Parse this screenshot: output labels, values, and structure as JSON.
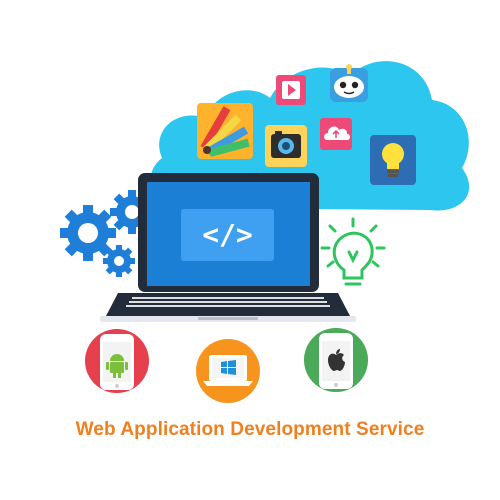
{
  "caption": "Web Application Development Service",
  "screen": {
    "code_symbol": "</>"
  },
  "colors": {
    "cloud": "#2dc6ee",
    "gear": "#1f7fd8",
    "laptop_body": "#232c3a",
    "laptop_screen": "#1b7fd6",
    "caption": "#f07f1e",
    "bulb_green": "#2ec55f",
    "android_circle": "#e6404f",
    "windows_circle": "#f7941d",
    "apple_circle": "#4aaa5a"
  },
  "icons": {
    "cloud_apps": [
      "palette-icon",
      "play-icon",
      "robot-icon",
      "camera-icon",
      "upload-cloud-icon",
      "lightbulb-icon"
    ],
    "platforms": [
      "android-phone-icon",
      "windows-laptop-icon",
      "apple-phone-icon"
    ]
  }
}
